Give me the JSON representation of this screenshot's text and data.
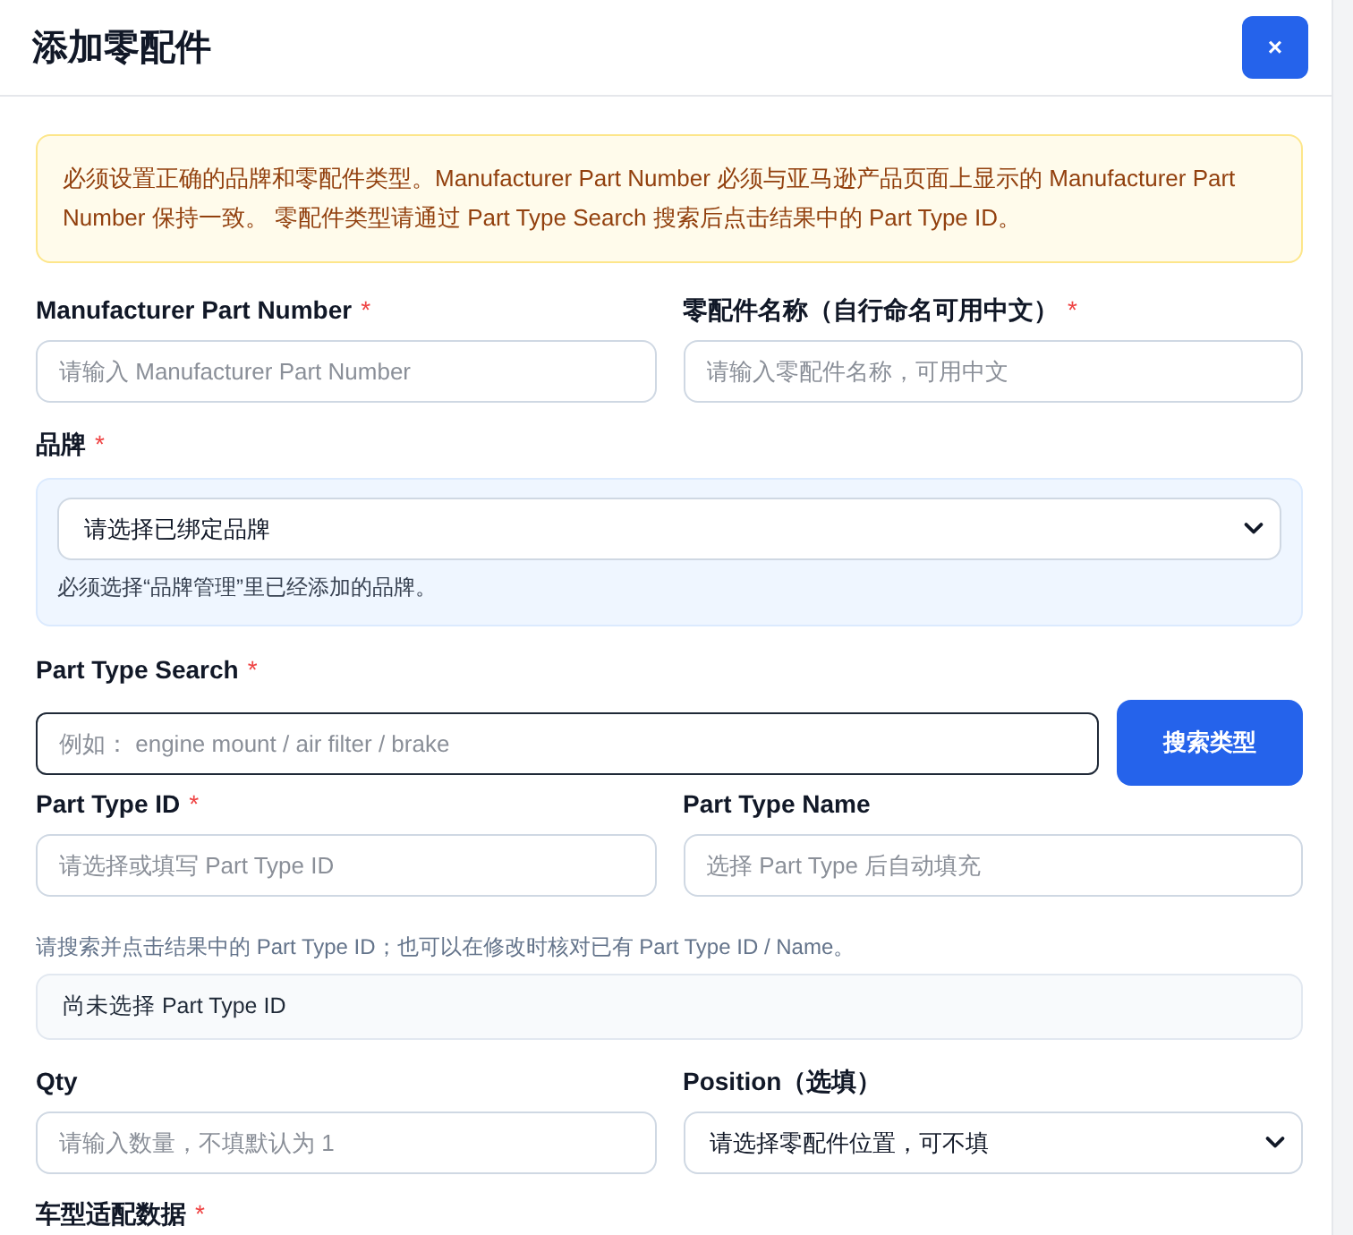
{
  "dialog": {
    "title": "添加零配件",
    "close_label": "×"
  },
  "notice": "必须设置正确的品牌和零配件类型。Manufacturer Part Number 必须与亚马逊产品页面上显示的 Manufacturer Part Number 保持一致。 零配件类型请通过 Part Type Search 搜索后点击结果中的 Part Type ID。",
  "form": [
    {
      "kind": "field_row",
      "fields": [
        {
          "label": "Manufacturer Part Number",
          "mark": "*",
          "control": {
            "kind": "input",
            "placeholder": "请输入 Manufacturer Part Number"
          }
        },
        {
          "label": "零配件名称（自行命名可用中文）",
          "mark": "*",
          "control": {
            "kind": "input",
            "placeholder": "请输入零配件名称，可用中文"
          }
        }
      ]
    },
    {
      "kind": "panel_field",
      "label": "品牌",
      "mark": "*",
      "control": {
        "kind": "select",
        "value": "请选择已绑定品牌"
      },
      "hint": "必须选择“品牌管理”里已经添加的品牌。"
    },
    {
      "kind": "search_field",
      "label": "Part Type Search",
      "mark": "*",
      "control": {
        "kind": "input",
        "placeholder": "例如： engine mount / air filter / brake",
        "focused": true
      },
      "button": "搜索类型"
    },
    {
      "kind": "field_row",
      "fields": [
        {
          "label": "Part Type ID",
          "mark": "*",
          "control": {
            "kind": "input",
            "placeholder": "请选择或填写 Part Type ID"
          }
        },
        {
          "label": "Part Type Name",
          "control": {
            "kind": "input",
            "placeholder": "选择 Part Type 后自动填充"
          }
        }
      ]
    },
    {
      "kind": "hint",
      "text": "请搜索并点击结果中的 Part Type ID；也可以在修改时核对已有 Part Type ID / Name。"
    },
    {
      "kind": "status_box",
      "text": "尚未选择 Part Type ID"
    },
    {
      "kind": "field_row",
      "fields": [
        {
          "label": "Qty",
          "control": {
            "kind": "input",
            "placeholder": "请输入数量，不填默认为 1"
          }
        },
        {
          "label": "Position（选填）",
          "control": {
            "kind": "select",
            "value": "请选择零配件位置，可不填"
          }
        }
      ]
    },
    {
      "kind": "label",
      "label": "车型适配数据",
      "mark": "*"
    }
  ]
}
